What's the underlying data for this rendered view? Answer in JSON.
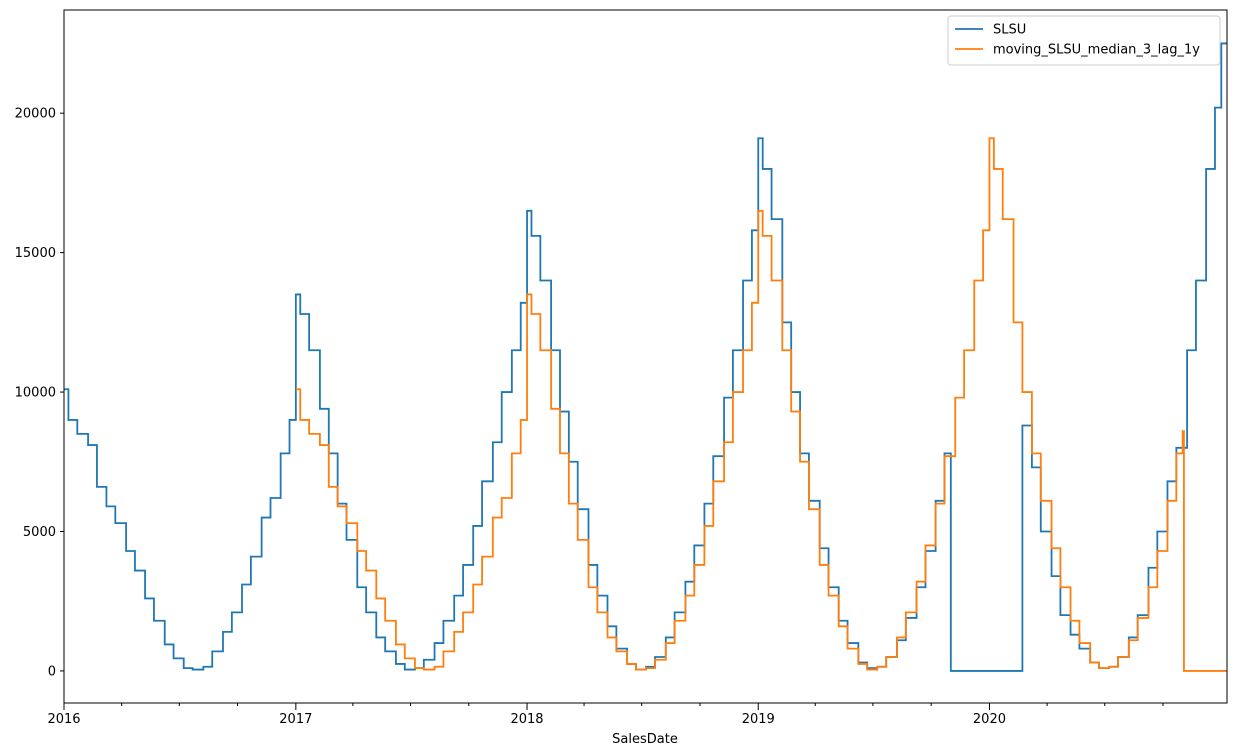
{
  "chart_data": {
    "type": "line",
    "xlabel": "SalesDate",
    "ylabel": "",
    "title": "",
    "xlim": [
      "2016-01-01",
      "2021-01-10"
    ],
    "ylim": [
      -1150,
      23700
    ],
    "x_ticks": [
      {
        "date": "2016-01-01",
        "label": "2016"
      },
      {
        "date": "2017-01-01",
        "label": "2017"
      },
      {
        "date": "2018-01-01",
        "label": "2018"
      },
      {
        "date": "2019-01-01",
        "label": "2019"
      },
      {
        "date": "2020-01-01",
        "label": "2020"
      }
    ],
    "y_ticks": [
      0,
      5000,
      10000,
      15000,
      20000
    ],
    "legend": {
      "position": "top-right"
    },
    "grid": false,
    "series": [
      {
        "name": "SLSU",
        "color": "#1f77b4",
        "points": [
          [
            "2016-01-01",
            10100
          ],
          [
            "2016-01-08",
            9000
          ],
          [
            "2016-01-22",
            8500
          ],
          [
            "2016-02-08",
            8100
          ],
          [
            "2016-02-22",
            6600
          ],
          [
            "2016-03-08",
            5900
          ],
          [
            "2016-03-22",
            5300
          ],
          [
            "2016-04-08",
            4300
          ],
          [
            "2016-04-22",
            3600
          ],
          [
            "2016-05-08",
            2600
          ],
          [
            "2016-05-22",
            1800
          ],
          [
            "2016-06-08",
            950
          ],
          [
            "2016-06-22",
            450
          ],
          [
            "2016-07-08",
            100
          ],
          [
            "2016-07-22",
            50
          ],
          [
            "2016-08-08",
            150
          ],
          [
            "2016-08-22",
            700
          ],
          [
            "2016-09-08",
            1400
          ],
          [
            "2016-09-22",
            2100
          ],
          [
            "2016-10-08",
            3100
          ],
          [
            "2016-10-22",
            4100
          ],
          [
            "2016-11-08",
            5500
          ],
          [
            "2016-11-22",
            6200
          ],
          [
            "2016-12-08",
            7800
          ],
          [
            "2016-12-22",
            9000
          ],
          [
            "2017-01-01",
            13500
          ],
          [
            "2017-01-08",
            12800
          ],
          [
            "2017-01-22",
            11500
          ],
          [
            "2017-02-08",
            9400
          ],
          [
            "2017-02-22",
            7800
          ],
          [
            "2017-03-08",
            6000
          ],
          [
            "2017-03-22",
            4700
          ],
          [
            "2017-04-08",
            3000
          ],
          [
            "2017-04-22",
            2100
          ],
          [
            "2017-05-08",
            1200
          ],
          [
            "2017-05-22",
            700
          ],
          [
            "2017-06-08",
            250
          ],
          [
            "2017-06-22",
            50
          ],
          [
            "2017-07-08",
            100
          ],
          [
            "2017-07-22",
            400
          ],
          [
            "2017-08-08",
            1000
          ],
          [
            "2017-08-22",
            1800
          ],
          [
            "2017-09-08",
            2700
          ],
          [
            "2017-09-22",
            3800
          ],
          [
            "2017-10-08",
            5200
          ],
          [
            "2017-10-22",
            6800
          ],
          [
            "2017-11-08",
            8200
          ],
          [
            "2017-11-22",
            10000
          ],
          [
            "2017-12-08",
            11500
          ],
          [
            "2017-12-22",
            13200
          ],
          [
            "2018-01-01",
            16500
          ],
          [
            "2018-01-08",
            15600
          ],
          [
            "2018-01-22",
            14000
          ],
          [
            "2018-02-08",
            11500
          ],
          [
            "2018-02-22",
            9300
          ],
          [
            "2018-03-08",
            7500
          ],
          [
            "2018-03-22",
            5800
          ],
          [
            "2018-04-08",
            3800
          ],
          [
            "2018-04-22",
            2700
          ],
          [
            "2018-05-08",
            1600
          ],
          [
            "2018-05-22",
            800
          ],
          [
            "2018-06-08",
            250
          ],
          [
            "2018-06-22",
            50
          ],
          [
            "2018-07-08",
            150
          ],
          [
            "2018-07-22",
            500
          ],
          [
            "2018-08-08",
            1200
          ],
          [
            "2018-08-22",
            2100
          ],
          [
            "2018-09-08",
            3200
          ],
          [
            "2018-09-22",
            4500
          ],
          [
            "2018-10-08",
            6000
          ],
          [
            "2018-10-22",
            7700
          ],
          [
            "2018-11-08",
            9800
          ],
          [
            "2018-11-22",
            11500
          ],
          [
            "2018-12-08",
            14000
          ],
          [
            "2018-12-22",
            15800
          ],
          [
            "2019-01-01",
            19100
          ],
          [
            "2019-01-08",
            18000
          ],
          [
            "2019-01-22",
            16200
          ],
          [
            "2019-02-08",
            12500
          ],
          [
            "2019-02-22",
            10000
          ],
          [
            "2019-03-08",
            7800
          ],
          [
            "2019-03-22",
            6100
          ],
          [
            "2019-04-08",
            4400
          ],
          [
            "2019-04-22",
            3000
          ],
          [
            "2019-05-08",
            1800
          ],
          [
            "2019-05-22",
            1000
          ],
          [
            "2019-06-08",
            300
          ],
          [
            "2019-06-22",
            100
          ],
          [
            "2019-07-08",
            150
          ],
          [
            "2019-07-22",
            500
          ],
          [
            "2019-08-08",
            1100
          ],
          [
            "2019-08-22",
            1900
          ],
          [
            "2019-09-08",
            3000
          ],
          [
            "2019-09-22",
            4300
          ],
          [
            "2019-10-08",
            6100
          ],
          [
            "2019-10-22",
            7800
          ],
          [
            "2019-11-01",
            0
          ],
          [
            "2020-02-22",
            8800
          ],
          [
            "2020-03-08",
            7300
          ],
          [
            "2020-03-22",
            5000
          ],
          [
            "2020-04-08",
            3400
          ],
          [
            "2020-04-22",
            2000
          ],
          [
            "2020-05-08",
            1300
          ],
          [
            "2020-05-22",
            800
          ],
          [
            "2020-06-08",
            300
          ],
          [
            "2020-06-22",
            100
          ],
          [
            "2020-07-08",
            150
          ],
          [
            "2020-07-22",
            500
          ],
          [
            "2020-08-08",
            1200
          ],
          [
            "2020-08-22",
            2000
          ],
          [
            "2020-09-08",
            3700
          ],
          [
            "2020-09-22",
            5000
          ],
          [
            "2020-10-08",
            6800
          ],
          [
            "2020-10-22",
            8000
          ],
          [
            "2020-11-08",
            11500
          ],
          [
            "2020-11-22",
            14000
          ],
          [
            "2020-12-08",
            18000
          ],
          [
            "2020-12-22",
            20200
          ],
          [
            "2021-01-01",
            22500
          ]
        ]
      },
      {
        "name": "moving_SLSU_median_3_lag_1y",
        "color": "#ff7f0e",
        "points": [
          [
            "2017-01-01",
            10100
          ],
          [
            "2017-01-08",
            9000
          ],
          [
            "2017-01-22",
            8500
          ],
          [
            "2017-02-08",
            8100
          ],
          [
            "2017-02-22",
            6600
          ],
          [
            "2017-03-08",
            5900
          ],
          [
            "2017-03-22",
            5300
          ],
          [
            "2017-04-08",
            4300
          ],
          [
            "2017-04-22",
            3600
          ],
          [
            "2017-05-08",
            2600
          ],
          [
            "2017-05-22",
            1800
          ],
          [
            "2017-06-08",
            950
          ],
          [
            "2017-06-22",
            450
          ],
          [
            "2017-07-08",
            100
          ],
          [
            "2017-07-22",
            50
          ],
          [
            "2017-08-08",
            150
          ],
          [
            "2017-08-22",
            700
          ],
          [
            "2017-09-08",
            1400
          ],
          [
            "2017-09-22",
            2100
          ],
          [
            "2017-10-08",
            3100
          ],
          [
            "2017-10-22",
            4100
          ],
          [
            "2017-11-08",
            5500
          ],
          [
            "2017-11-22",
            6200
          ],
          [
            "2017-12-08",
            7800
          ],
          [
            "2017-12-22",
            9000
          ],
          [
            "2018-01-01",
            13500
          ],
          [
            "2018-01-08",
            12800
          ],
          [
            "2018-01-22",
            11500
          ],
          [
            "2018-02-08",
            9400
          ],
          [
            "2018-02-22",
            7800
          ],
          [
            "2018-03-08",
            6000
          ],
          [
            "2018-03-22",
            4700
          ],
          [
            "2018-04-08",
            3000
          ],
          [
            "2018-04-22",
            2100
          ],
          [
            "2018-05-08",
            1200
          ],
          [
            "2018-05-22",
            700
          ],
          [
            "2018-06-08",
            250
          ],
          [
            "2018-06-22",
            50
          ],
          [
            "2018-07-08",
            100
          ],
          [
            "2018-07-22",
            400
          ],
          [
            "2018-08-08",
            1000
          ],
          [
            "2018-08-22",
            1800
          ],
          [
            "2018-09-08",
            2700
          ],
          [
            "2018-09-22",
            3800
          ],
          [
            "2018-10-08",
            5200
          ],
          [
            "2018-10-22",
            6800
          ],
          [
            "2018-11-08",
            8200
          ],
          [
            "2018-11-22",
            10000
          ],
          [
            "2018-12-08",
            11500
          ],
          [
            "2018-12-22",
            13200
          ],
          [
            "2019-01-01",
            16500
          ],
          [
            "2019-01-08",
            15600
          ],
          [
            "2019-01-22",
            14000
          ],
          [
            "2019-02-08",
            11500
          ],
          [
            "2019-02-22",
            9300
          ],
          [
            "2019-03-08",
            7500
          ],
          [
            "2019-03-22",
            5800
          ],
          [
            "2019-04-08",
            3800
          ],
          [
            "2019-04-22",
            2700
          ],
          [
            "2019-05-08",
            1600
          ],
          [
            "2019-05-22",
            800
          ],
          [
            "2019-06-08",
            250
          ],
          [
            "2019-06-22",
            50
          ],
          [
            "2019-07-08",
            150
          ],
          [
            "2019-07-22",
            500
          ],
          [
            "2019-08-08",
            1200
          ],
          [
            "2019-08-22",
            2100
          ],
          [
            "2019-09-08",
            3200
          ],
          [
            "2019-09-22",
            4500
          ],
          [
            "2019-10-08",
            6000
          ],
          [
            "2019-10-22",
            7700
          ],
          [
            "2019-11-08",
            9800
          ],
          [
            "2019-11-22",
            11500
          ],
          [
            "2019-12-08",
            14000
          ],
          [
            "2019-12-22",
            15800
          ],
          [
            "2020-01-01",
            19100
          ],
          [
            "2020-01-08",
            18000
          ],
          [
            "2020-01-22",
            16200
          ],
          [
            "2020-02-08",
            12500
          ],
          [
            "2020-02-22",
            10000
          ],
          [
            "2020-03-08",
            7800
          ],
          [
            "2020-03-22",
            6100
          ],
          [
            "2020-04-08",
            4400
          ],
          [
            "2020-04-22",
            3000
          ],
          [
            "2020-05-08",
            1800
          ],
          [
            "2020-05-22",
            1000
          ],
          [
            "2020-06-08",
            300
          ],
          [
            "2020-06-22",
            100
          ],
          [
            "2020-07-08",
            150
          ],
          [
            "2020-07-22",
            500
          ],
          [
            "2020-08-08",
            1100
          ],
          [
            "2020-08-22",
            1900
          ],
          [
            "2020-09-08",
            3000
          ],
          [
            "2020-09-22",
            4300
          ],
          [
            "2020-10-08",
            6100
          ],
          [
            "2020-10-22",
            7800
          ],
          [
            "2020-11-01",
            8600
          ],
          [
            "2020-11-03",
            0
          ],
          [
            "2021-01-10",
            0
          ]
        ]
      }
    ]
  }
}
